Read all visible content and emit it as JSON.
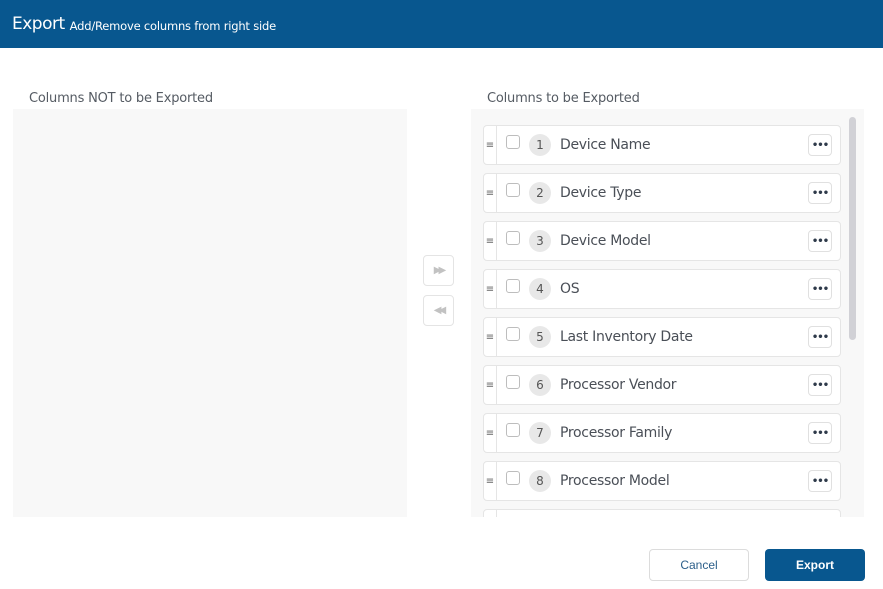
{
  "header": {
    "title": "Export",
    "subtitle": "Add/Remove columns from right side"
  },
  "left": {
    "label": "Columns NOT to be Exported",
    "items": []
  },
  "right": {
    "label": "Columns to be Exported",
    "items": [
      {
        "num": "1",
        "label": "Device Name"
      },
      {
        "num": "2",
        "label": "Device Type"
      },
      {
        "num": "3",
        "label": "Device Model"
      },
      {
        "num": "4",
        "label": "OS"
      },
      {
        "num": "5",
        "label": "Last Inventory Date"
      },
      {
        "num": "6",
        "label": "Processor Vendor"
      },
      {
        "num": "7",
        "label": "Processor Family"
      },
      {
        "num": "8",
        "label": "Processor Model"
      }
    ]
  },
  "icons": {
    "grip": "≡",
    "more": "•••",
    "move_right": "▶▶",
    "move_left": "◀◀"
  },
  "footer": {
    "cancel_label": "Cancel",
    "export_label": "Export"
  }
}
